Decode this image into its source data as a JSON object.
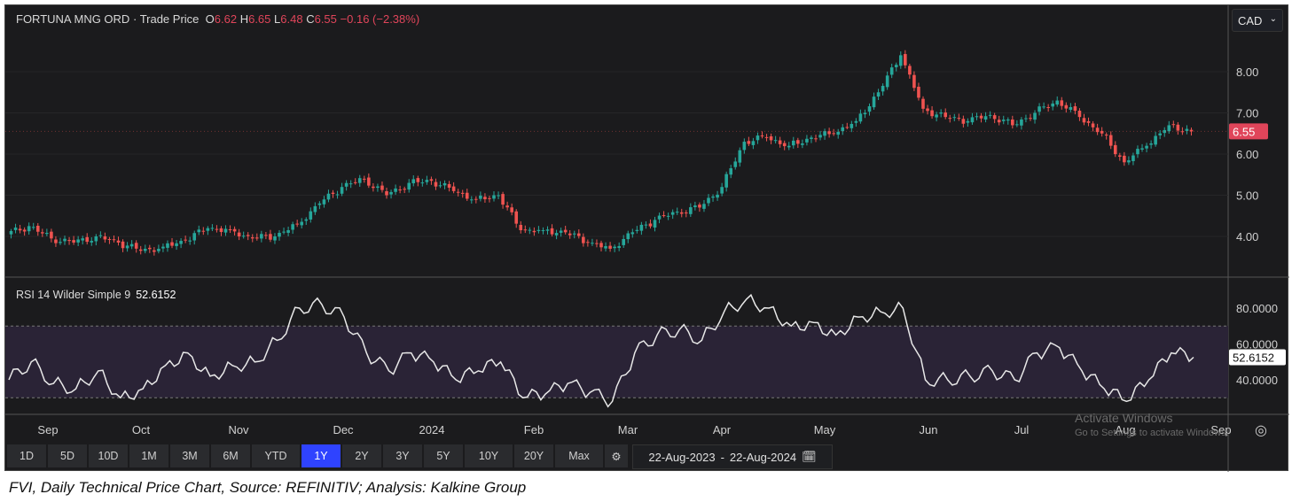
{
  "header": {
    "symbol": "FORTUNA MNG ORD",
    "sep": "·",
    "source": "Trade Price",
    "o_label": "O",
    "o": "6.62",
    "h_label": "H",
    "h": "6.65",
    "l_label": "L",
    "l": "6.48",
    "c_label": "C",
    "c": "6.55",
    "change": "−0.16 (−2.38%)"
  },
  "currency": "CAD",
  "currency_chevron": "⌄",
  "rsi": {
    "label": "RSI 14 Wilder Simple 9",
    "value": "52.6152"
  },
  "last_price_label": "6.55",
  "range_buttons": [
    "1D",
    "5D",
    "10D",
    "1M",
    "3M",
    "6M",
    "YTD",
    "1Y",
    "2Y",
    "3Y",
    "5Y",
    "10Y",
    "20Y",
    "Max"
  ],
  "active_range": "1Y",
  "date_range": {
    "from": "22-Aug-2023",
    "sep": "-",
    "to": "22-Aug-2024"
  },
  "watermark": {
    "line1": "Activate Windows",
    "line2": "Go to Settings to activate Windows."
  },
  "caption": "FVI, Daily Technical Price Chart, Source: REFINITIV; Analysis: Kalkine Group",
  "colors": {
    "up": "#26a69a",
    "down": "#ef5350",
    "rsi": "#e8e8e8",
    "band": "#2a2336"
  },
  "chart_data": [
    {
      "type": "candlestick",
      "title": "FORTUNA MNG ORD · Trade Price",
      "ylim": [
        3,
        9
      ],
      "yticks": [
        "4.00",
        "5.00",
        "6.00",
        "7.00",
        "8.00"
      ],
      "x_labels": [
        "Sep",
        "Oct",
        "Nov",
        "Dec",
        "2024",
        "Feb",
        "Mar",
        "Apr",
        "May",
        "Jun",
        "Jul",
        "Aug",
        "Sep"
      ],
      "weekly_close": [
        4.05,
        4.25,
        3.95,
        3.85,
        4.0,
        3.85,
        3.65,
        3.75,
        3.9,
        4.2,
        4.15,
        3.95,
        4.0,
        4.3,
        4.8,
        5.2,
        5.4,
        5.0,
        5.3,
        5.35,
        5.1,
        4.9,
        5.0,
        4.15,
        4.15,
        4.1,
        3.85,
        3.7,
        4.1,
        4.4,
        4.6,
        4.7,
        5.2,
        6.3,
        6.4,
        6.2,
        6.4,
        6.5,
        6.8,
        7.5,
        8.4,
        7.1,
        6.9,
        6.8,
        6.95,
        6.7,
        7.0,
        7.3,
        6.9,
        6.5,
        5.8,
        6.2,
        6.7,
        6.55
      ]
    },
    {
      "type": "line",
      "title": "RSI 14 Wilder Simple 9",
      "ylim": [
        20,
        90
      ],
      "yticks": [
        "40.0000",
        "60.0000",
        "80.0000"
      ],
      "bands": [
        30,
        70
      ],
      "weekly_values": [
        40,
        50,
        38,
        35,
        45,
        30,
        35,
        48,
        55,
        42,
        48,
        50,
        62,
        80,
        82,
        75,
        55,
        45,
        55,
        50,
        40,
        45,
        50,
        30,
        32,
        38,
        33,
        28,
        55,
        65,
        68,
        62,
        78,
        85,
        80,
        70,
        72,
        65,
        75,
        78,
        80,
        40,
        40,
        42,
        45,
        40,
        55,
        58,
        45,
        35,
        28,
        40,
        55,
        52.6152
      ]
    }
  ]
}
